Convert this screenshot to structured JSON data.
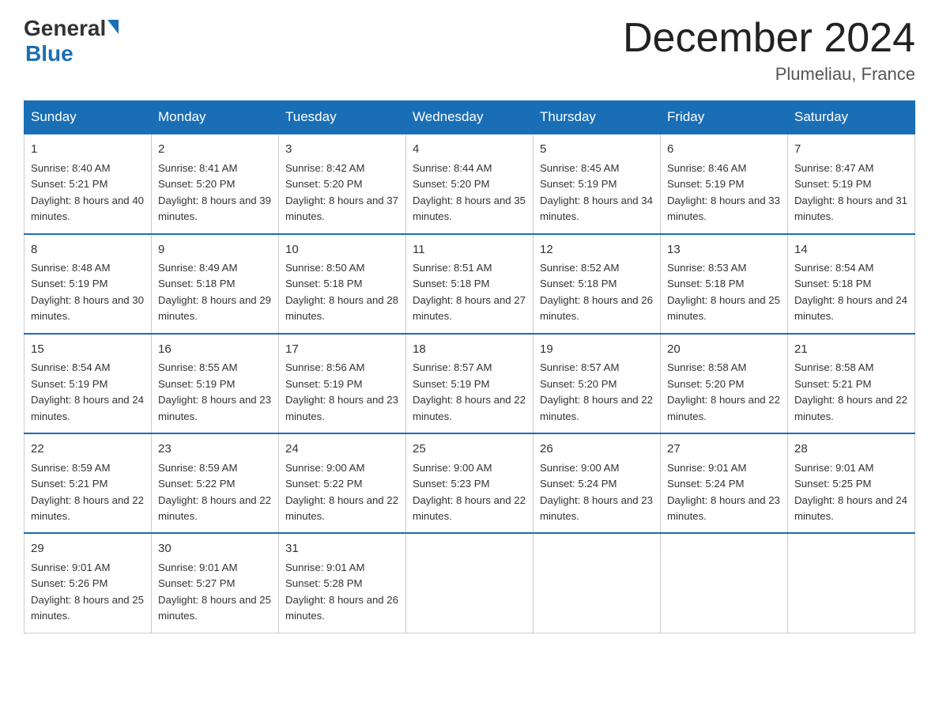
{
  "header": {
    "logo": {
      "general": "General",
      "blue": "Blue"
    },
    "title": "December 2024",
    "location": "Plumeliau, France"
  },
  "weekdays": [
    "Sunday",
    "Monday",
    "Tuesday",
    "Wednesday",
    "Thursday",
    "Friday",
    "Saturday"
  ],
  "weeks": [
    [
      {
        "day": "1",
        "sunrise": "8:40 AM",
        "sunset": "5:21 PM",
        "daylight": "8 hours and 40 minutes."
      },
      {
        "day": "2",
        "sunrise": "8:41 AM",
        "sunset": "5:20 PM",
        "daylight": "8 hours and 39 minutes."
      },
      {
        "day": "3",
        "sunrise": "8:42 AM",
        "sunset": "5:20 PM",
        "daylight": "8 hours and 37 minutes."
      },
      {
        "day": "4",
        "sunrise": "8:44 AM",
        "sunset": "5:20 PM",
        "daylight": "8 hours and 35 minutes."
      },
      {
        "day": "5",
        "sunrise": "8:45 AM",
        "sunset": "5:19 PM",
        "daylight": "8 hours and 34 minutes."
      },
      {
        "day": "6",
        "sunrise": "8:46 AM",
        "sunset": "5:19 PM",
        "daylight": "8 hours and 33 minutes."
      },
      {
        "day": "7",
        "sunrise": "8:47 AM",
        "sunset": "5:19 PM",
        "daylight": "8 hours and 31 minutes."
      }
    ],
    [
      {
        "day": "8",
        "sunrise": "8:48 AM",
        "sunset": "5:19 PM",
        "daylight": "8 hours and 30 minutes."
      },
      {
        "day": "9",
        "sunrise": "8:49 AM",
        "sunset": "5:18 PM",
        "daylight": "8 hours and 29 minutes."
      },
      {
        "day": "10",
        "sunrise": "8:50 AM",
        "sunset": "5:18 PM",
        "daylight": "8 hours and 28 minutes."
      },
      {
        "day": "11",
        "sunrise": "8:51 AM",
        "sunset": "5:18 PM",
        "daylight": "8 hours and 27 minutes."
      },
      {
        "day": "12",
        "sunrise": "8:52 AM",
        "sunset": "5:18 PM",
        "daylight": "8 hours and 26 minutes."
      },
      {
        "day": "13",
        "sunrise": "8:53 AM",
        "sunset": "5:18 PM",
        "daylight": "8 hours and 25 minutes."
      },
      {
        "day": "14",
        "sunrise": "8:54 AM",
        "sunset": "5:18 PM",
        "daylight": "8 hours and 24 minutes."
      }
    ],
    [
      {
        "day": "15",
        "sunrise": "8:54 AM",
        "sunset": "5:19 PM",
        "daylight": "8 hours and 24 minutes."
      },
      {
        "day": "16",
        "sunrise": "8:55 AM",
        "sunset": "5:19 PM",
        "daylight": "8 hours and 23 minutes."
      },
      {
        "day": "17",
        "sunrise": "8:56 AM",
        "sunset": "5:19 PM",
        "daylight": "8 hours and 23 minutes."
      },
      {
        "day": "18",
        "sunrise": "8:57 AM",
        "sunset": "5:19 PM",
        "daylight": "8 hours and 22 minutes."
      },
      {
        "day": "19",
        "sunrise": "8:57 AM",
        "sunset": "5:20 PM",
        "daylight": "8 hours and 22 minutes."
      },
      {
        "day": "20",
        "sunrise": "8:58 AM",
        "sunset": "5:20 PM",
        "daylight": "8 hours and 22 minutes."
      },
      {
        "day": "21",
        "sunrise": "8:58 AM",
        "sunset": "5:21 PM",
        "daylight": "8 hours and 22 minutes."
      }
    ],
    [
      {
        "day": "22",
        "sunrise": "8:59 AM",
        "sunset": "5:21 PM",
        "daylight": "8 hours and 22 minutes."
      },
      {
        "day": "23",
        "sunrise": "8:59 AM",
        "sunset": "5:22 PM",
        "daylight": "8 hours and 22 minutes."
      },
      {
        "day": "24",
        "sunrise": "9:00 AM",
        "sunset": "5:22 PM",
        "daylight": "8 hours and 22 minutes."
      },
      {
        "day": "25",
        "sunrise": "9:00 AM",
        "sunset": "5:23 PM",
        "daylight": "8 hours and 22 minutes."
      },
      {
        "day": "26",
        "sunrise": "9:00 AM",
        "sunset": "5:24 PM",
        "daylight": "8 hours and 23 minutes."
      },
      {
        "day": "27",
        "sunrise": "9:01 AM",
        "sunset": "5:24 PM",
        "daylight": "8 hours and 23 minutes."
      },
      {
        "day": "28",
        "sunrise": "9:01 AM",
        "sunset": "5:25 PM",
        "daylight": "8 hours and 24 minutes."
      }
    ],
    [
      {
        "day": "29",
        "sunrise": "9:01 AM",
        "sunset": "5:26 PM",
        "daylight": "8 hours and 25 minutes."
      },
      {
        "day": "30",
        "sunrise": "9:01 AM",
        "sunset": "5:27 PM",
        "daylight": "8 hours and 25 minutes."
      },
      {
        "day": "31",
        "sunrise": "9:01 AM",
        "sunset": "5:28 PM",
        "daylight": "8 hours and 26 minutes."
      },
      null,
      null,
      null,
      null
    ]
  ]
}
